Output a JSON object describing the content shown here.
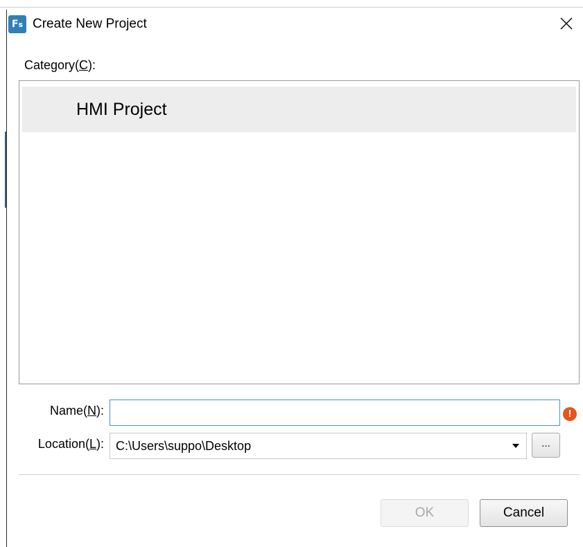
{
  "window": {
    "title": "Create New Project",
    "icon_text": "F",
    "icon_sub": "s"
  },
  "category": {
    "label_prefix": "Category(",
    "label_key": "C",
    "label_suffix": "):",
    "items": [
      {
        "label": "HMI Project",
        "selected": true
      }
    ]
  },
  "form": {
    "name_label_prefix": "Name(",
    "name_label_key": "N",
    "name_label_suffix": "):",
    "name_value": "",
    "name_warning_icon": "!",
    "location_label_prefix": "Location(",
    "location_label_key": "L",
    "location_label_suffix": "):",
    "location_value": "C:\\Users\\suppo\\Desktop",
    "browse_label": "..."
  },
  "buttons": {
    "ok_label": "OK",
    "ok_enabled": false,
    "cancel_label": "Cancel"
  },
  "colors": {
    "icon_blue": "#2f7fb8",
    "warning": "#e8541c",
    "focus_border": "#4a90d9",
    "selected_item_bg": "#ededed"
  }
}
